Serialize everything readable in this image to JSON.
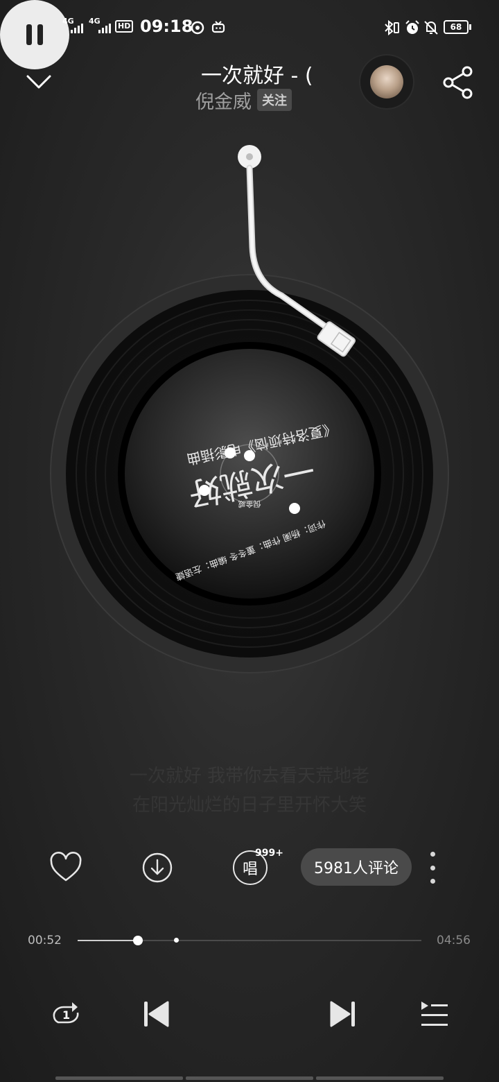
{
  "status_bar": {
    "net1": "4G",
    "net2": "4G",
    "hd": "HD",
    "time": "09:18",
    "battery": "68"
  },
  "header": {
    "title": "一次就好 - (",
    "artist": "倪金威",
    "follow_label": "关注",
    "icons": [
      "chevron-down-icon",
      "avatar",
      "share-icon"
    ]
  },
  "disc": {
    "credits": "作词：杨阑   作曲：董冬冬   编曲：左语婕",
    "album_line": "《夏洛特烦恼》电影插曲",
    "artist_small": "倪金威",
    "logo_text": "一次就好"
  },
  "lyrics": [
    "一次就好 我带你去看天荒地老",
    "在阳光灿烂的日子里开怀大笑"
  ],
  "actions": {
    "sing_count": "999+",
    "sing_label": "唱",
    "comments_label": "5981人评论"
  },
  "progress": {
    "current": "00:52",
    "total": "04:56",
    "played_fraction": 0.176,
    "buffered_fraction": 0.286
  },
  "controls": {
    "repeat_badge": "1",
    "icons": [
      "repeat-one-icon",
      "previous-icon",
      "pause-icon",
      "next-icon",
      "playlist-icon"
    ]
  },
  "colors": {
    "background": "#262626",
    "accent": "#ffffff",
    "pill": "#4a4a4a"
  }
}
